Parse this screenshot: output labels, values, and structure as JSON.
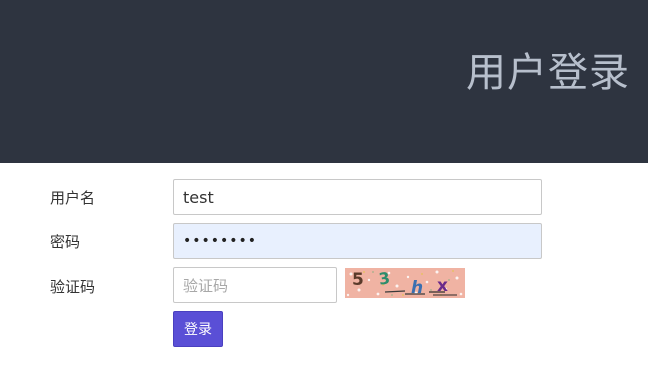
{
  "header": {
    "title": "用户登录",
    "background_color": "#2e3440",
    "title_color": "#b7bfcc"
  },
  "form": {
    "username": {
      "label": "用户名",
      "value": "test"
    },
    "password": {
      "label": "密码",
      "masked_value": "••••••••"
    },
    "captcha": {
      "label": "验证码",
      "value": "",
      "placeholder": "验证码",
      "image_text": "53hx"
    },
    "submit_label": "登录",
    "accent_color": "#5a4fd6"
  }
}
